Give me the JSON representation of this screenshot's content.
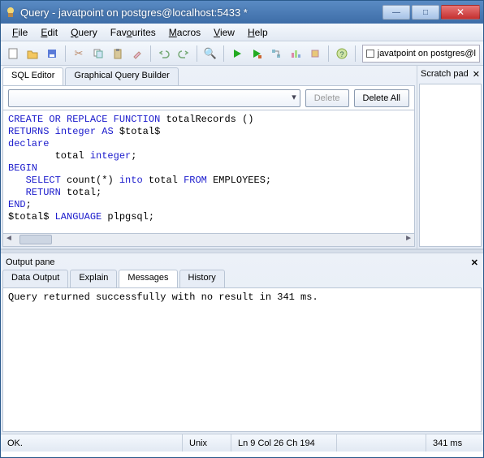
{
  "window": {
    "title": "Query - javatpoint on postgres@localhost:5433 *"
  },
  "menu": {
    "file": "File",
    "edit": "Edit",
    "query": "Query",
    "favourites": "Favourites",
    "macros": "Macros",
    "view": "View",
    "help": "Help"
  },
  "connection_label": "javatpoint on postgres@l",
  "main_tabs": {
    "sql_editor": "SQL Editor",
    "gqb": "Graphical Query Builder"
  },
  "editor_toolbar": {
    "delete": "Delete",
    "delete_all": "Delete All"
  },
  "sql_lines": [
    "CREATE OR REPLACE FUNCTION totalRecords ()",
    "RETURNS integer AS $total$",
    "declare",
    "        total integer;",
    "BEGIN",
    "   SELECT count(*) into total FROM EMPLOYEES;",
    "   RETURN total;",
    "END;",
    "$total$ LANGUAGE plpgsql;"
  ],
  "scratch": {
    "title": "Scratch pad",
    "close": "✕"
  },
  "output": {
    "title": "Output pane",
    "close": "✕",
    "tabs": {
      "data": "Data Output",
      "explain": "Explain",
      "messages": "Messages",
      "history": "History"
    },
    "message": "Query returned successfully with no result in 341 ms."
  },
  "status": {
    "ok": "OK.",
    "enc": "Unix",
    "pos": "Ln 9 Col 26 Ch 194",
    "time": "341 ms"
  }
}
